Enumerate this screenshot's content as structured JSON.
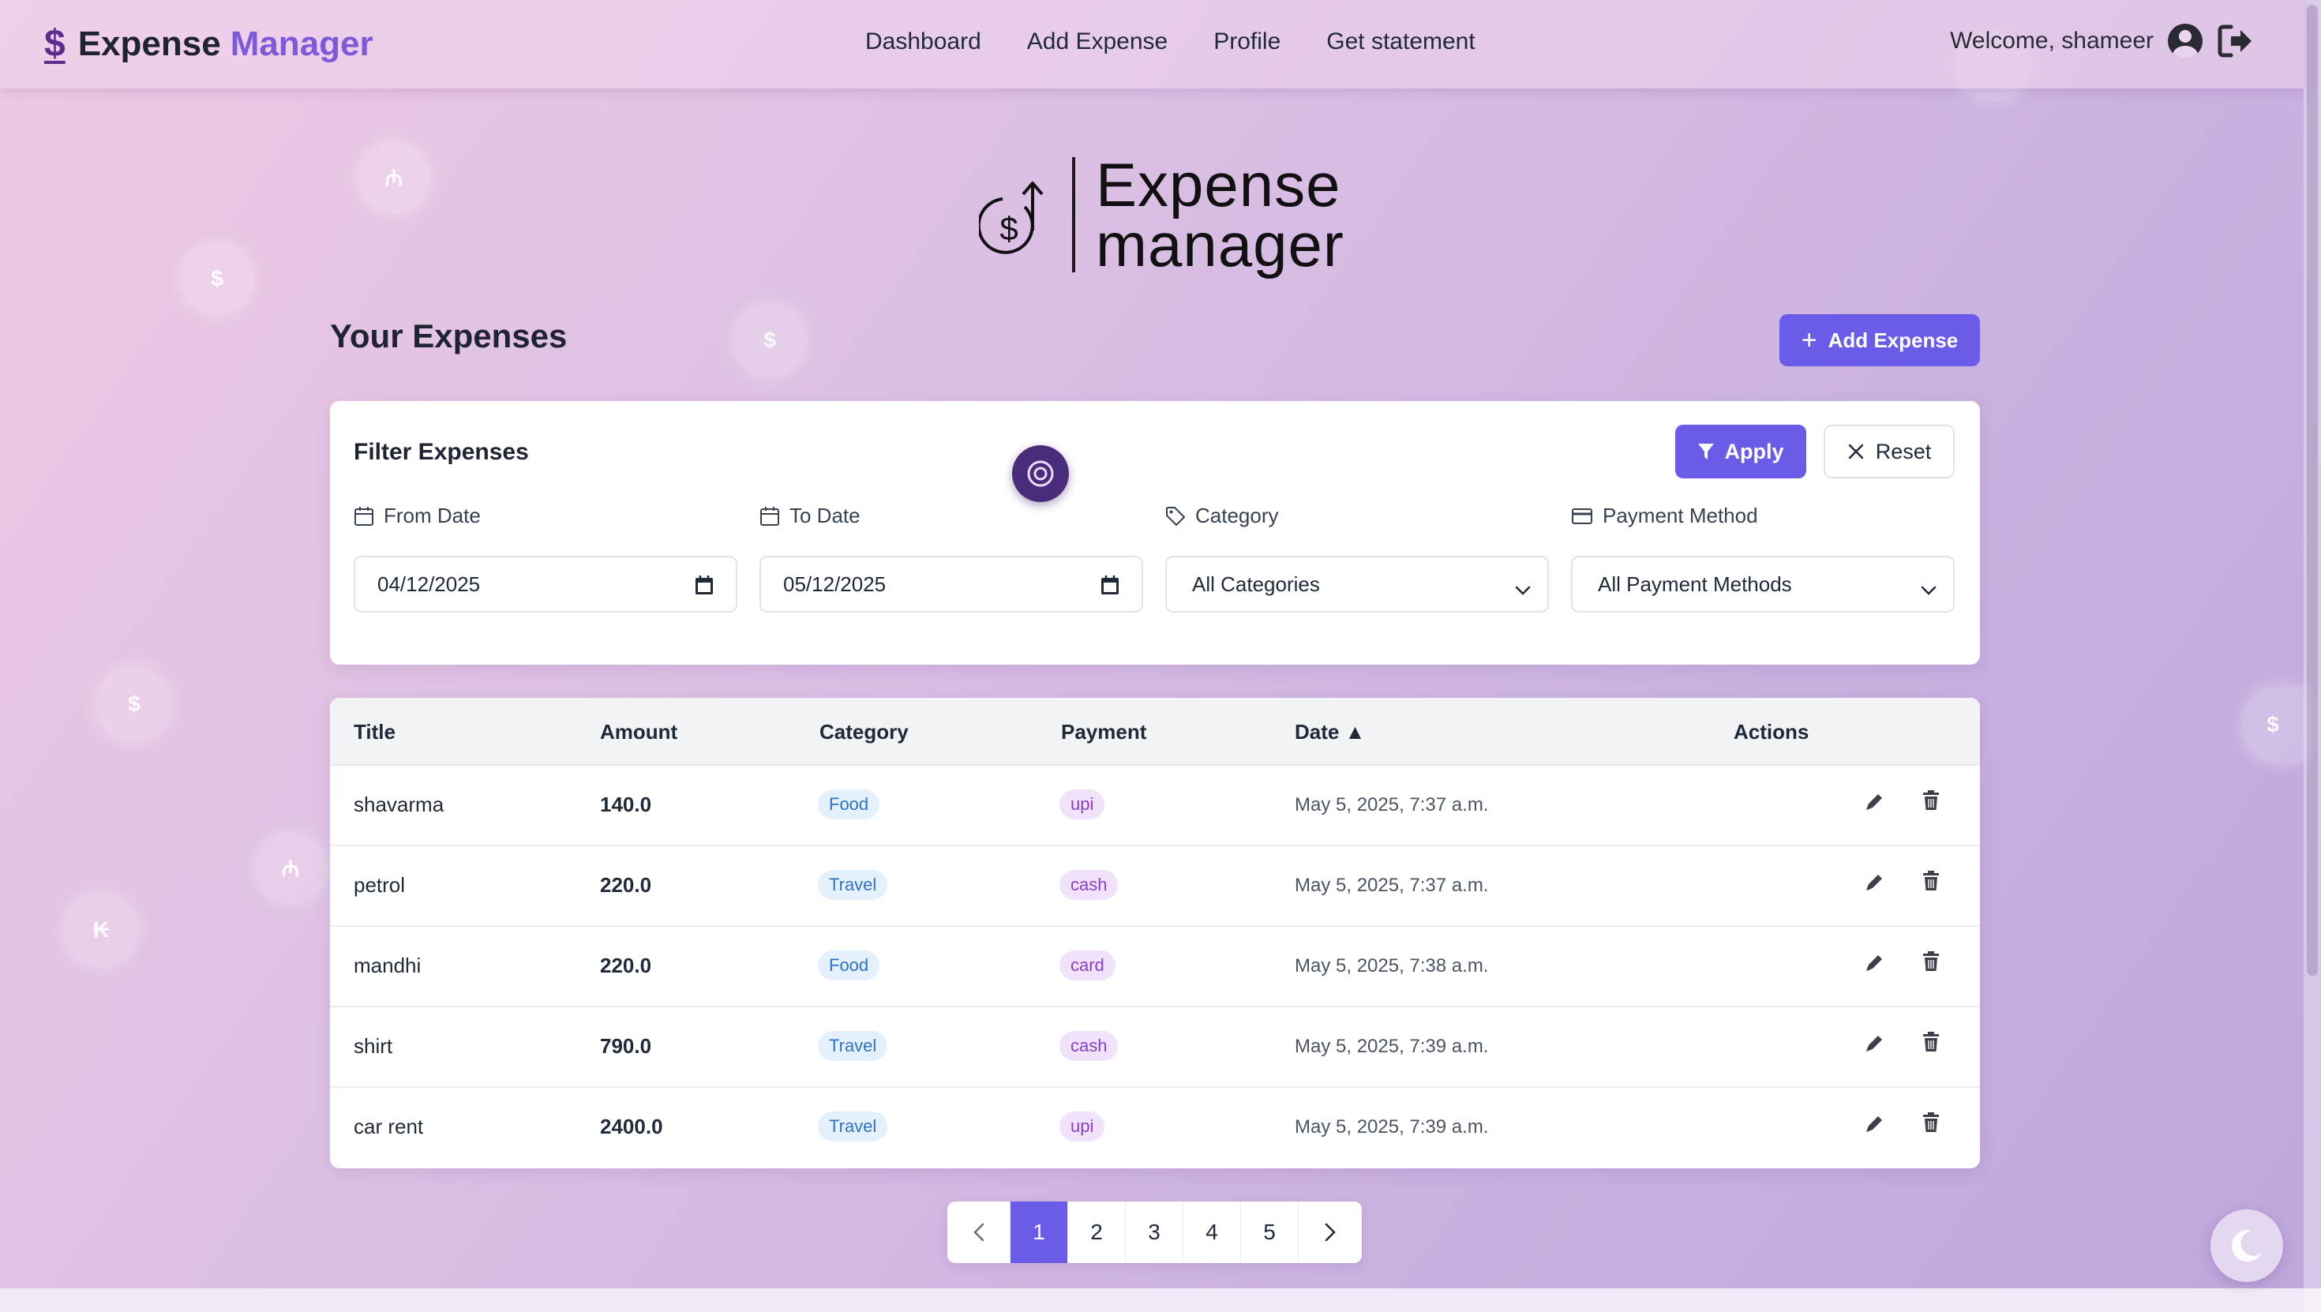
{
  "navbar": {
    "brand_symbol": "$",
    "brand_part1": "Expense",
    "brand_part2": "Manager",
    "links": [
      "Dashboard",
      "Add Expense",
      "Profile",
      "Get statement"
    ],
    "welcome": "Welcome, shameer"
  },
  "hero": {
    "line1": "Expense",
    "line2": "manager"
  },
  "section": {
    "title": "Your Expenses",
    "add_button": "Add Expense"
  },
  "filter": {
    "title": "Filter Expenses",
    "apply": "Apply",
    "reset": "Reset",
    "from_label": "From Date",
    "from_value": "04/12/2025",
    "to_label": "To Date",
    "to_value": "05/12/2025",
    "category_label": "Category",
    "category_value": "All Categories",
    "payment_label": "Payment Method",
    "payment_value": "All Payment Methods"
  },
  "table": {
    "headers": [
      "Title",
      "Amount",
      "Category",
      "Payment",
      "Date ▲",
      "Actions"
    ],
    "rows": [
      {
        "title": "shavarma",
        "amount": "140.0",
        "category": "Food",
        "payment": "upi",
        "date": "May 5, 2025, 7:37 a.m."
      },
      {
        "title": "petrol",
        "amount": "220.0",
        "category": "Travel",
        "payment": "cash",
        "date": "May 5, 2025, 7:37 a.m."
      },
      {
        "title": "mandhi",
        "amount": "220.0",
        "category": "Food",
        "payment": "card",
        "date": "May 5, 2025, 7:38 a.m."
      },
      {
        "title": "shirt",
        "amount": "790.0",
        "category": "Travel",
        "payment": "cash",
        "date": "May 5, 2025, 7:39 a.m."
      },
      {
        "title": "car rent",
        "amount": "2400.0",
        "category": "Travel",
        "payment": "upi",
        "date": "May 5, 2025, 7:39 a.m."
      }
    ]
  },
  "pagination": {
    "pages": [
      "1",
      "2",
      "3",
      "4",
      "5"
    ],
    "current": "1"
  },
  "colors": {
    "accent": "#6a5ce8",
    "brand_purple": "#7c5ad9",
    "category_badge_text": "#2f73c2",
    "payment_badge_text": "#8a3fc6"
  },
  "icons": [
    "dollar-icon",
    "user-circle-icon",
    "logout-icon",
    "plus-icon",
    "filter-icon",
    "close-icon",
    "calendar-icon",
    "tag-icon",
    "credit-card-icon",
    "chevron-down-icon",
    "edit-icon",
    "trash-icon",
    "chevron-left-icon",
    "chevron-right-icon",
    "moon-icon"
  ]
}
